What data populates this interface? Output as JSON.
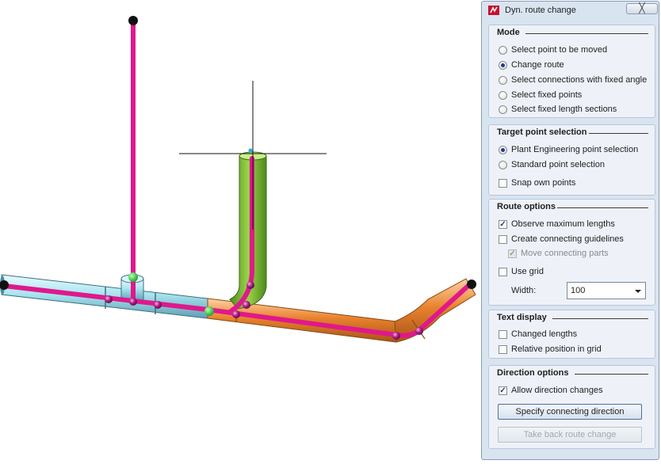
{
  "window": {
    "title": "Dyn. route change",
    "close_glyph": "╳"
  },
  "mode": {
    "title": "Mode",
    "options": [
      {
        "label": "Select point to be moved",
        "selected": false
      },
      {
        "label": "Change route",
        "selected": true
      },
      {
        "label": "Select connections with fixed angle",
        "selected": false
      },
      {
        "label": "Select fixed points",
        "selected": false
      },
      {
        "label": "Select fixed length sections",
        "selected": false
      }
    ]
  },
  "target": {
    "title": "Target point selection",
    "options": [
      {
        "label": "Plant Engineering point selection",
        "selected": true
      },
      {
        "label": "Standard point selection",
        "selected": false
      }
    ],
    "snap_label": "Snap own points",
    "snap_checked": false
  },
  "route": {
    "title": "Route options",
    "observe_label": "Observe maximum lengths",
    "guidelines_label": "Create connecting guidelines",
    "move_parts_label": "Move connecting parts",
    "use_grid_label": "Use grid",
    "width_label": "Width:",
    "width_value": "100"
  },
  "text_display": {
    "title": "Text display",
    "changed_label": "Changed lengths",
    "relative_label": "Relative position in grid"
  },
  "direction": {
    "title": "Direction options",
    "allow_label": "Allow direction changes",
    "specify_button": "Specify connecting direction",
    "takeback_button": "Take back route change"
  },
  "colors": {
    "route_line": "#e0188c",
    "pipe_blue": "#a8e4f0",
    "pipe_orange": "#e8822e",
    "pipe_green": "#78b832",
    "panel_bg": "#d9e4f1"
  }
}
